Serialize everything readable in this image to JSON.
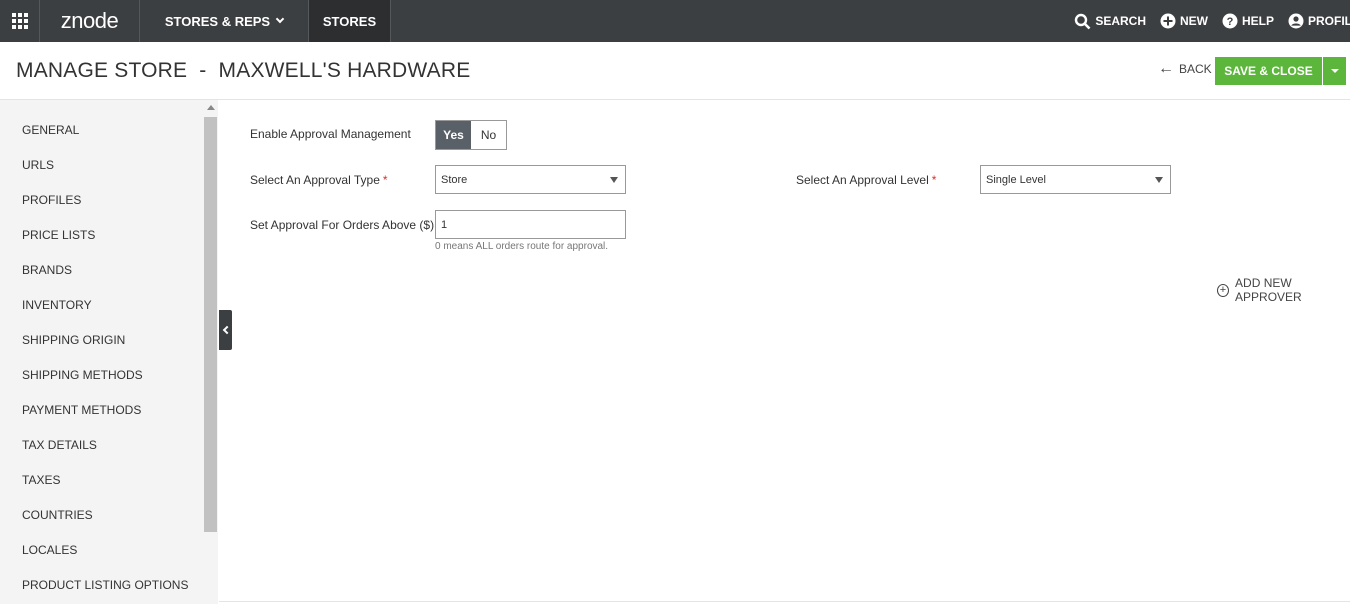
{
  "topbar": {
    "logo": "znode",
    "nav_stores_reps": "STORES & REPS",
    "nav_stores": "STORES",
    "search": "SEARCH",
    "new": "NEW",
    "help": "HELP",
    "profile": "PROFILE"
  },
  "header": {
    "title": "MANAGE STORE  -  MAXWELL'S HARDWARE",
    "back": "BACK",
    "save_close": "SAVE & CLOSE"
  },
  "sidebar": {
    "items": [
      {
        "label": "GENERAL"
      },
      {
        "label": "URLS"
      },
      {
        "label": "PROFILES"
      },
      {
        "label": "PRICE LISTS"
      },
      {
        "label": "BRANDS"
      },
      {
        "label": "INVENTORY"
      },
      {
        "label": "SHIPPING ORIGIN"
      },
      {
        "label": "SHIPPING METHODS"
      },
      {
        "label": "PAYMENT METHODS"
      },
      {
        "label": "TAX DETAILS"
      },
      {
        "label": "TAXES"
      },
      {
        "label": "COUNTRIES"
      },
      {
        "label": "LOCALES"
      },
      {
        "label": "PRODUCT LISTING OPTIONS"
      }
    ]
  },
  "form": {
    "enable_approval_label": "Enable Approval Management",
    "toggle_yes": "Yes",
    "toggle_no": "No",
    "toggle_selected": "Yes",
    "approval_type_label": "Select An Approval Type",
    "approval_type_value": "Store",
    "approval_level_label": "Select An Approval Level",
    "approval_level_value": "Single Level",
    "required_marker": "*",
    "orders_above_label": "Set Approval For Orders Above ($)",
    "orders_above_value": "1",
    "orders_above_hint": "0 means ALL orders route for approval.",
    "add_approver": "ADD NEW APPROVER"
  },
  "colors": {
    "topbar_bg": "#3c3f41",
    "accent_green": "#5cb63b",
    "required_red": "#d9312b"
  }
}
